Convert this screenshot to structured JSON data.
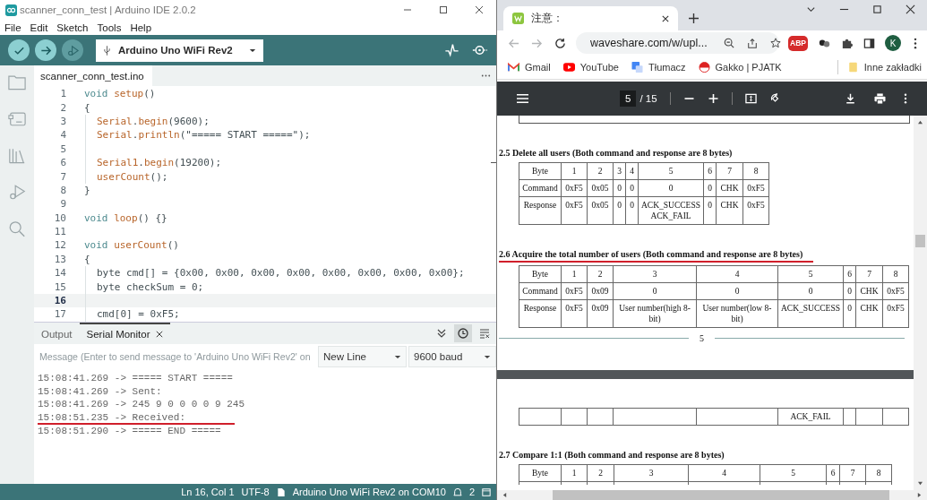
{
  "ide": {
    "window": {
      "title": "scanner_conn_test | Arduino IDE 2.0.2"
    },
    "menu": [
      "File",
      "Edit",
      "Sketch",
      "Tools",
      "Help"
    ],
    "toolbar": {
      "buttons": [
        {
          "kind": "verify",
          "disabled": false
        },
        {
          "kind": "upload",
          "disabled": false
        },
        {
          "kind": "debug",
          "disabled": true
        }
      ],
      "board": "Arduino Uno WiFi Rev2"
    },
    "editor_tabs": [
      {
        "label": "scanner_conn_test.ino",
        "selected": true
      }
    ],
    "code": [
      {
        "number": "1",
        "indented": false,
        "current": false,
        "tokens": [
          {
            "kind": "kw",
            "text": "void "
          },
          {
            "kind": "fn",
            "text": "setup"
          },
          {
            "kind": "plain",
            "text": "()"
          }
        ]
      },
      {
        "number": "2",
        "indented": false,
        "current": false,
        "tokens": [
          {
            "kind": "plain",
            "text": "{"
          }
        ]
      },
      {
        "number": "3",
        "indented": true,
        "current": false,
        "tokens": [
          {
            "kind": "fn",
            "text": "Serial"
          },
          {
            "kind": "plain",
            "text": "."
          },
          {
            "kind": "fn",
            "text": "begin"
          },
          {
            "kind": "plain",
            "text": "(9600);"
          }
        ]
      },
      {
        "number": "4",
        "indented": true,
        "current": false,
        "tokens": [
          {
            "kind": "fn",
            "text": "Serial"
          },
          {
            "kind": "plain",
            "text": "."
          },
          {
            "kind": "fn",
            "text": "println"
          },
          {
            "kind": "plain",
            "text": "(\"===== START =====\");"
          }
        ]
      },
      {
        "number": "5",
        "indented": true,
        "current": false
      },
      {
        "number": "6",
        "indented": true,
        "current": false,
        "tokens": [
          {
            "kind": "fn",
            "text": "Serial1"
          },
          {
            "kind": "plain",
            "text": "."
          },
          {
            "kind": "fn",
            "text": "begin"
          },
          {
            "kind": "plain",
            "text": "(19200);"
          }
        ]
      },
      {
        "number": "7",
        "indented": true,
        "current": false,
        "tokens": [
          {
            "kind": "fn",
            "text": "userCount"
          },
          {
            "kind": "plain",
            "text": "();"
          }
        ]
      },
      {
        "number": "8",
        "indented": false,
        "current": false,
        "tokens": [
          {
            "kind": "plain",
            "text": "}"
          }
        ]
      },
      {
        "number": "9",
        "indented": false,
        "current": false
      },
      {
        "number": "10",
        "indented": false,
        "current": false,
        "tokens": [
          {
            "kind": "kw",
            "text": "void "
          },
          {
            "kind": "fn",
            "text": "loop"
          },
          {
            "kind": "plain",
            "text": "() {}"
          }
        ]
      },
      {
        "number": "11",
        "indented": false,
        "current": false
      },
      {
        "number": "12",
        "indented": false,
        "current": false,
        "tokens": [
          {
            "kind": "kw",
            "text": "void "
          },
          {
            "kind": "fn",
            "text": "userCount"
          },
          {
            "kind": "plain",
            "text": "()"
          }
        ]
      },
      {
        "number": "13",
        "indented": false,
        "current": false,
        "tokens": [
          {
            "kind": "plain",
            "text": "{"
          }
        ]
      },
      {
        "number": "14",
        "indented": true,
        "current": false,
        "tokens": [
          {
            "kind": "plain",
            "text": "byte cmd[] = {0x00, 0x00, 0x00, 0x00, 0x00, 0x00, 0x00, 0x00};"
          }
        ]
      },
      {
        "number": "15",
        "indented": true,
        "current": false,
        "tokens": [
          {
            "kind": "plain",
            "text": "byte checkSum = 0;"
          }
        ]
      },
      {
        "number": "16",
        "indented": true,
        "current": true
      },
      {
        "number": "17",
        "indented": true,
        "current": false,
        "tokens": [
          {
            "kind": "plain",
            "text": "cmd[0] = 0xF5;"
          }
        ]
      }
    ],
    "panel_tabs": [
      {
        "label": "Output",
        "selected": false,
        "closable": false
      },
      {
        "label": "Serial Monitor",
        "selected": true,
        "closable": true
      }
    ],
    "panel_toggles": [
      {
        "kind": "autoscroll",
        "on": false
      },
      {
        "kind": "timestamp",
        "on": true
      },
      {
        "kind": "clear",
        "on": false
      }
    ],
    "serial": {
      "placeholder": "Message (Enter to send message to 'Arduino Uno WiFi Rev2' on",
      "line_ending": "New Line",
      "baud": "9600 baud"
    },
    "log": [
      {
        "text": "15:08:41.269 -> ===== START =====",
        "highlighted": false
      },
      {
        "text": "15:08:41.269 -> Sent:",
        "highlighted": false
      },
      {
        "text": "15:08:41.269 -> 245 9 0 0 0 0 9 245",
        "highlighted": false
      },
      {
        "text": "15:08:51.235 -> Received:",
        "highlighted": true
      },
      {
        "text": "15:08:51.290 -> ===== END =====",
        "highlighted": false
      }
    ],
    "status_bar": {
      "position": "Ln 16, Col 1",
      "encoding": "UTF-8",
      "board": "Arduino Uno WiFi Rev2 on COM10",
      "notifications": "2"
    }
  },
  "browser": {
    "tabs": [
      {
        "title": "注意：",
        "selected": true
      }
    ],
    "nav": [
      {
        "kind": "back",
        "disabled": true
      },
      {
        "kind": "forward",
        "disabled": true
      },
      {
        "kind": "reload",
        "disabled": false
      }
    ],
    "url": "waveshare.com/w/upl...",
    "abp_badge": "ABP",
    "avatar": "K",
    "bookmarks": [
      {
        "kind": "gmail",
        "label": "Gmail"
      },
      {
        "kind": "youtube",
        "label": "YouTube"
      },
      {
        "kind": "translate",
        "label": "Tłumacz"
      },
      {
        "kind": "gakko",
        "label": "Gakko | PJATK"
      }
    ],
    "other_bookmarks": "Inne zakładki"
  },
  "pdf": {
    "toolbar": {
      "page": "5",
      "total": "/ 15"
    },
    "pages": [
      {
        "blocks": [
          {
            "kind": "heading",
            "text": "2.5 Delete all users (Both command and response are 8 bytes)",
            "underlined": false
          },
          {
            "kind": "table",
            "cut_off": false,
            "rows": [
              [
                "Byte",
                "1",
                "2",
                "3",
                "4",
                "5",
                "6",
                "7",
                "8"
              ],
              [
                "Command",
                "0xF5",
                "0x05",
                "0",
                "0",
                "0",
                "0",
                "CHK",
                "0xF5"
              ],
              [
                "Response",
                "0xF5",
                "0x05",
                "0",
                "0",
                "ACK_SUCCESS ACK_FAIL",
                "0",
                "CHK",
                "0xF5"
              ]
            ]
          },
          {
            "kind": "heading",
            "text": "2.6 Acquire the total number of users (Both command and response are 8 bytes)",
            "underlined": true
          },
          {
            "kind": "table",
            "cut_off": false,
            "rows": [
              [
                "Byte",
                "1",
                "2",
                "3",
                "4",
                "5",
                "6",
                "7",
                "8"
              ],
              [
                "Command",
                "0xF5",
                "0x09",
                "0",
                "0",
                "0",
                "0",
                "CHK",
                "0xF5"
              ],
              [
                "Response",
                "0xF5",
                "0x09",
                "User number(high 8-bit)",
                "User number(low 8-bit)",
                "ACK_SUCCESS",
                "0",
                "CHK",
                "0xF5"
              ]
            ]
          },
          {
            "kind": "footer",
            "text": "5"
          }
        ]
      },
      {
        "blocks": [
          {
            "kind": "table",
            "cut_off": false,
            "rows": [
              [
                null,
                null,
                null,
                null,
                null,
                "ACK_FAIL",
                null,
                null,
                null
              ]
            ]
          },
          {
            "kind": "heading",
            "text": "2.7 Compare 1:1 (Both command and response are 8 bytes)",
            "underlined": false
          },
          {
            "kind": "table",
            "cut_off": true,
            "rows": [
              [
                "Byte",
                "1",
                "2",
                "3",
                "4",
                "5",
                "6",
                "7",
                "8"
              ]
            ]
          }
        ]
      }
    ]
  }
}
